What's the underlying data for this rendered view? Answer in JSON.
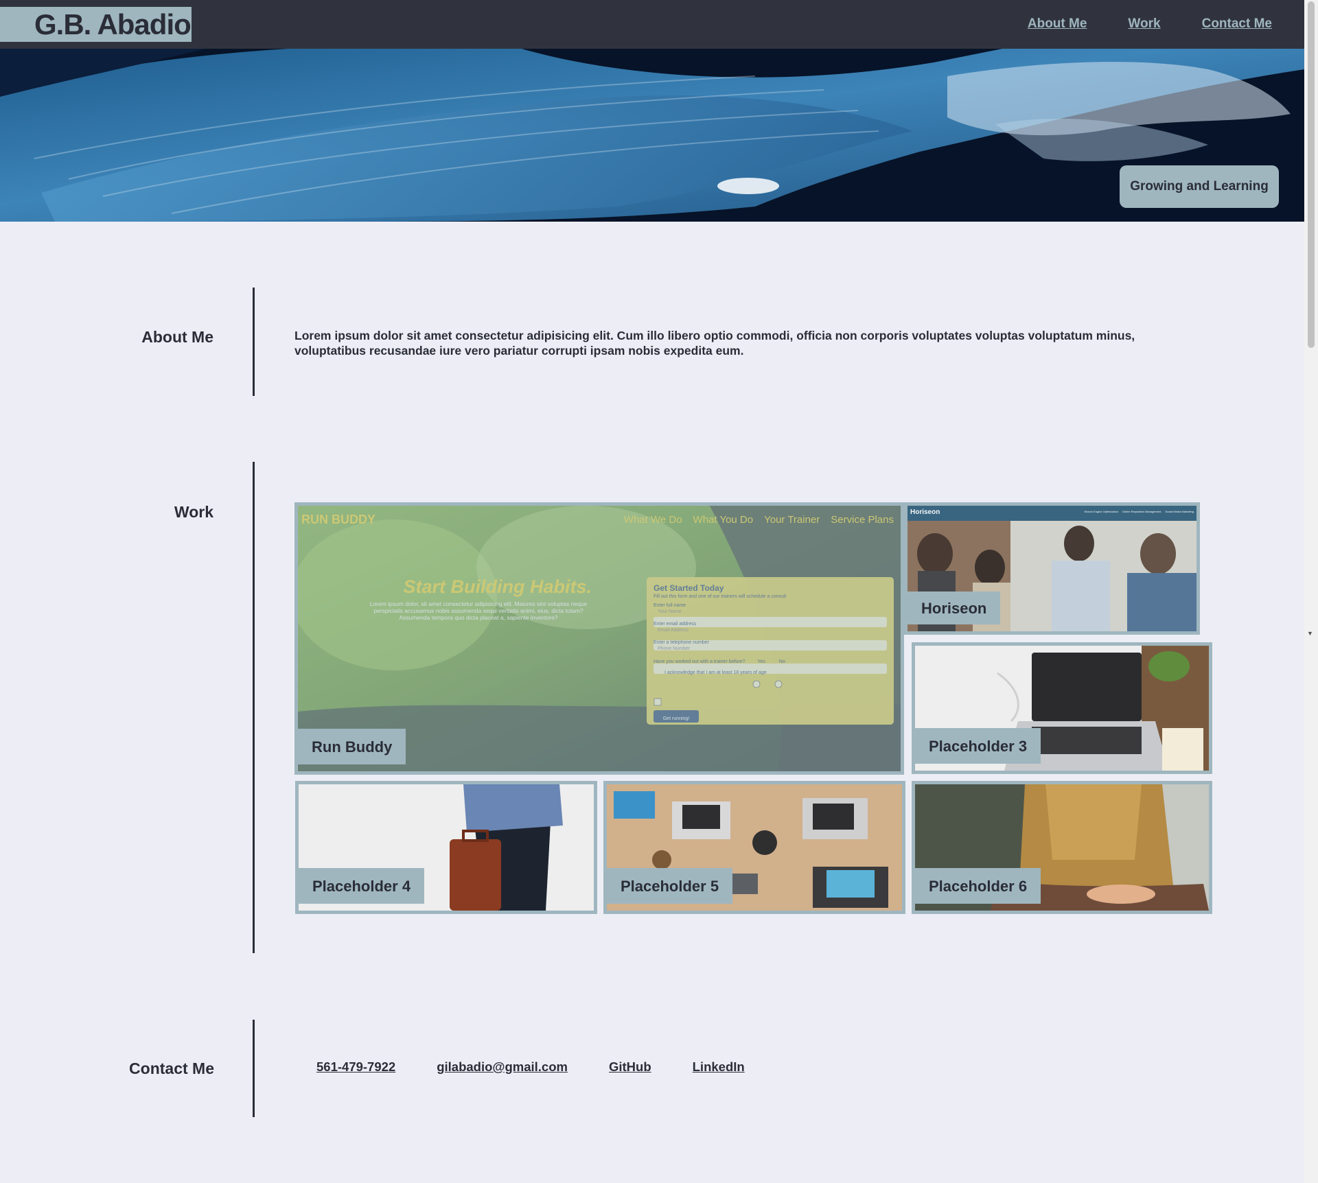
{
  "header": {
    "brand": "G.B. Abadio",
    "nav": [
      "About Me",
      "Work",
      "Contact Me"
    ]
  },
  "hero": {
    "badge": "Growing and Learning"
  },
  "about": {
    "heading": "About Me",
    "text": "Lorem ipsum dolor sit amet consectetur adipisicing elit. Cum illo libero optio commodi, officia non corporis voluptates voluptas voluptatum minus, voluptatibus recusandae iure vero pariatur corrupti ipsam nobis expedita eum."
  },
  "work": {
    "heading": "Work",
    "projects": [
      {
        "title": "Run Buddy"
      },
      {
        "title": "Horiseon"
      },
      {
        "title": "Placeholder 3"
      },
      {
        "title": "Placeholder 4"
      },
      {
        "title": "Placeholder 5"
      },
      {
        "title": "Placeholder 6"
      }
    ],
    "run_buddy_preview": {
      "logo": "RUN BUDDY",
      "nav": [
        "What We Do",
        "What You Do",
        "Your Trainer",
        "Service Plans"
      ],
      "headline": "Start Building Habits.",
      "body": "Lorem ipsum dolor, sit amet consectetur adipisicing elit. Maiores sint voluptas neque perspiciatis accusamus nobis assumenda sequi veritatis animi, eius, dicta totam? Assumenda tempora quo dicta placeat a, sapiente inventore?",
      "form_title": "Get Started Today",
      "form_sub": "Fill out this form and one of our trainers will schedule a consult",
      "name_label": "Enter full name",
      "name_placeholder": "Your Name",
      "email_label": "Enter email address",
      "email_placeholder": "Email Address",
      "phone_label": "Enter a telephone number",
      "phone_placeholder": "Phone Number",
      "trainer_q": "Have you worked out with a trainer before?",
      "yes": "Yes",
      "no": "No",
      "ack": "I acknowledge that I am at least 18 years of age",
      "button": "Get running!"
    },
    "horiseon_preview": {
      "logo": "Horiseon",
      "nav": [
        "Search Engine Optimization",
        "Online Reputation Management",
        "Social Media Marketing"
      ]
    }
  },
  "contact": {
    "heading": "Contact Me",
    "links": [
      "561-479-7922",
      "gilabadio@gmail.com",
      "GitHub",
      "LinkedIn"
    ]
  },
  "colors": {
    "header_bg": "#30333d",
    "accent": "#9fb6bf",
    "page_bg": "#edeef5",
    "text": "#2a2d37"
  }
}
